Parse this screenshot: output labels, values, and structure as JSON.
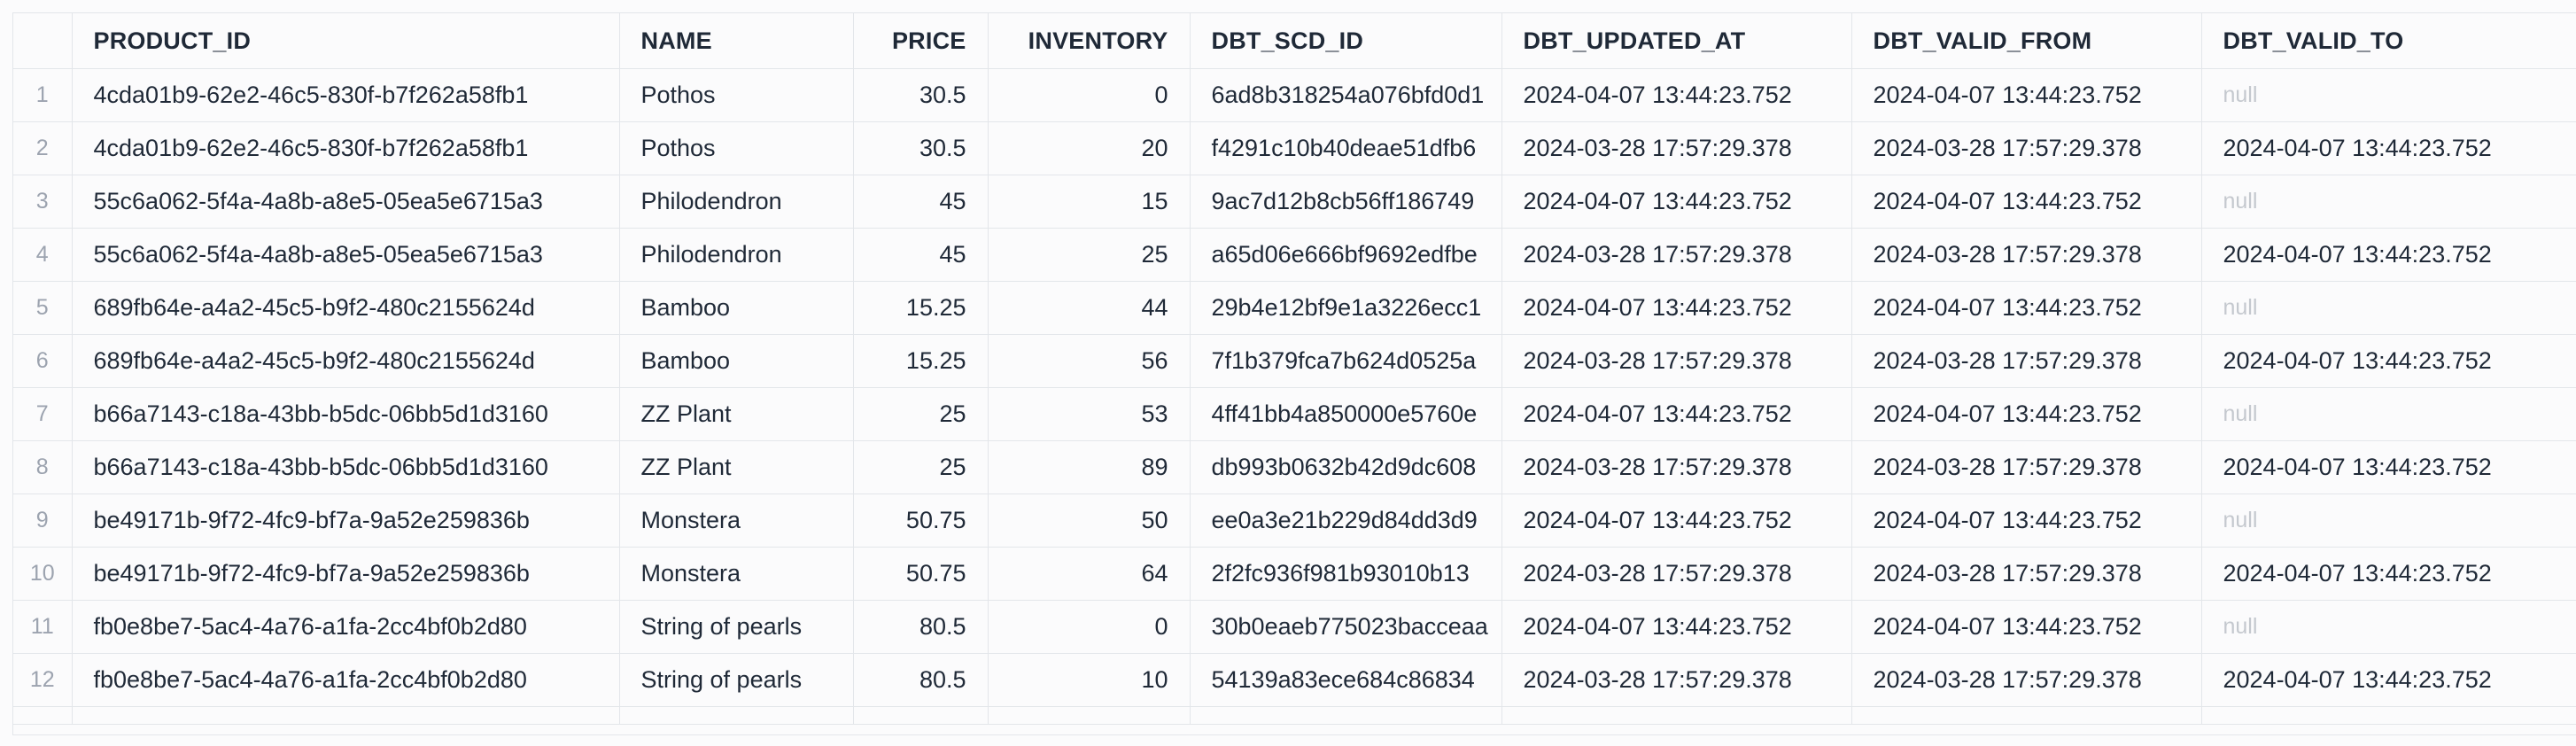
{
  "table": {
    "columns": [
      "PRODUCT_ID",
      "NAME",
      "PRICE",
      "INVENTORY",
      "DBT_SCD_ID",
      "DBT_UPDATED_AT",
      "DBT_VALID_FROM",
      "DBT_VALID_TO"
    ],
    "rows": [
      {
        "n": "1",
        "product_id": "4cda01b9-62e2-46c5-830f-b7f262a58fb1",
        "name": "Pothos",
        "price": "30.5",
        "inventory": "0",
        "scd_id": "6ad8b318254a076bfd0d1",
        "updated_at": "2024-04-07 13:44:23.752",
        "valid_from": "2024-04-07 13:44:23.752",
        "valid_to": "null"
      },
      {
        "n": "2",
        "product_id": "4cda01b9-62e2-46c5-830f-b7f262a58fb1",
        "name": "Pothos",
        "price": "30.5",
        "inventory": "20",
        "scd_id": "f4291c10b40deae51dfb6",
        "updated_at": "2024-03-28 17:57:29.378",
        "valid_from": "2024-03-28 17:57:29.378",
        "valid_to": "2024-04-07 13:44:23.752"
      },
      {
        "n": "3",
        "product_id": "55c6a062-5f4a-4a8b-a8e5-05ea5e6715a3",
        "name": "Philodendron",
        "price": "45",
        "inventory": "15",
        "scd_id": "9ac7d12b8cb56ff186749",
        "updated_at": "2024-04-07 13:44:23.752",
        "valid_from": "2024-04-07 13:44:23.752",
        "valid_to": "null"
      },
      {
        "n": "4",
        "product_id": "55c6a062-5f4a-4a8b-a8e5-05ea5e6715a3",
        "name": "Philodendron",
        "price": "45",
        "inventory": "25",
        "scd_id": "a65d06e666bf9692edfbe",
        "updated_at": "2024-03-28 17:57:29.378",
        "valid_from": "2024-03-28 17:57:29.378",
        "valid_to": "2024-04-07 13:44:23.752"
      },
      {
        "n": "5",
        "product_id": "689fb64e-a4a2-45c5-b9f2-480c2155624d",
        "name": "Bamboo",
        "price": "15.25",
        "inventory": "44",
        "scd_id": "29b4e12bf9e1a3226ecc1",
        "updated_at": "2024-04-07 13:44:23.752",
        "valid_from": "2024-04-07 13:44:23.752",
        "valid_to": "null"
      },
      {
        "n": "6",
        "product_id": "689fb64e-a4a2-45c5-b9f2-480c2155624d",
        "name": "Bamboo",
        "price": "15.25",
        "inventory": "56",
        "scd_id": "7f1b379fca7b624d0525a",
        "updated_at": "2024-03-28 17:57:29.378",
        "valid_from": "2024-03-28 17:57:29.378",
        "valid_to": "2024-04-07 13:44:23.752"
      },
      {
        "n": "7",
        "product_id": "b66a7143-c18a-43bb-b5dc-06bb5d1d3160",
        "name": "ZZ Plant",
        "price": "25",
        "inventory": "53",
        "scd_id": "4ff41bb4a850000e5760e",
        "updated_at": "2024-04-07 13:44:23.752",
        "valid_from": "2024-04-07 13:44:23.752",
        "valid_to": "null"
      },
      {
        "n": "8",
        "product_id": "b66a7143-c18a-43bb-b5dc-06bb5d1d3160",
        "name": "ZZ Plant",
        "price": "25",
        "inventory": "89",
        "scd_id": "db993b0632b42d9dc608",
        "updated_at": "2024-03-28 17:57:29.378",
        "valid_from": "2024-03-28 17:57:29.378",
        "valid_to": "2024-04-07 13:44:23.752"
      },
      {
        "n": "9",
        "product_id": "be49171b-9f72-4fc9-bf7a-9a52e259836b",
        "name": "Monstera",
        "price": "50.75",
        "inventory": "50",
        "scd_id": "ee0a3e21b229d84dd3d9",
        "updated_at": "2024-04-07 13:44:23.752",
        "valid_from": "2024-04-07 13:44:23.752",
        "valid_to": "null"
      },
      {
        "n": "10",
        "product_id": "be49171b-9f72-4fc9-bf7a-9a52e259836b",
        "name": "Monstera",
        "price": "50.75",
        "inventory": "64",
        "scd_id": "2f2fc936f981b93010b13",
        "updated_at": "2024-03-28 17:57:29.378",
        "valid_from": "2024-03-28 17:57:29.378",
        "valid_to": "2024-04-07 13:44:23.752"
      },
      {
        "n": "11",
        "product_id": "fb0e8be7-5ac4-4a76-a1fa-2cc4bf0b2d80",
        "name": "String of pearls",
        "price": "80.5",
        "inventory": "0",
        "scd_id": "30b0eaeb775023bacceaa",
        "updated_at": "2024-04-07 13:44:23.752",
        "valid_from": "2024-04-07 13:44:23.752",
        "valid_to": "null"
      },
      {
        "n": "12",
        "product_id": "fb0e8be7-5ac4-4a76-a1fa-2cc4bf0b2d80",
        "name": "String of pearls",
        "price": "80.5",
        "inventory": "10",
        "scd_id": "54139a83ece684c86834",
        "updated_at": "2024-03-28 17:57:29.378",
        "valid_from": "2024-03-28 17:57:29.378",
        "valid_to": "2024-04-07 13:44:23.752"
      }
    ]
  }
}
